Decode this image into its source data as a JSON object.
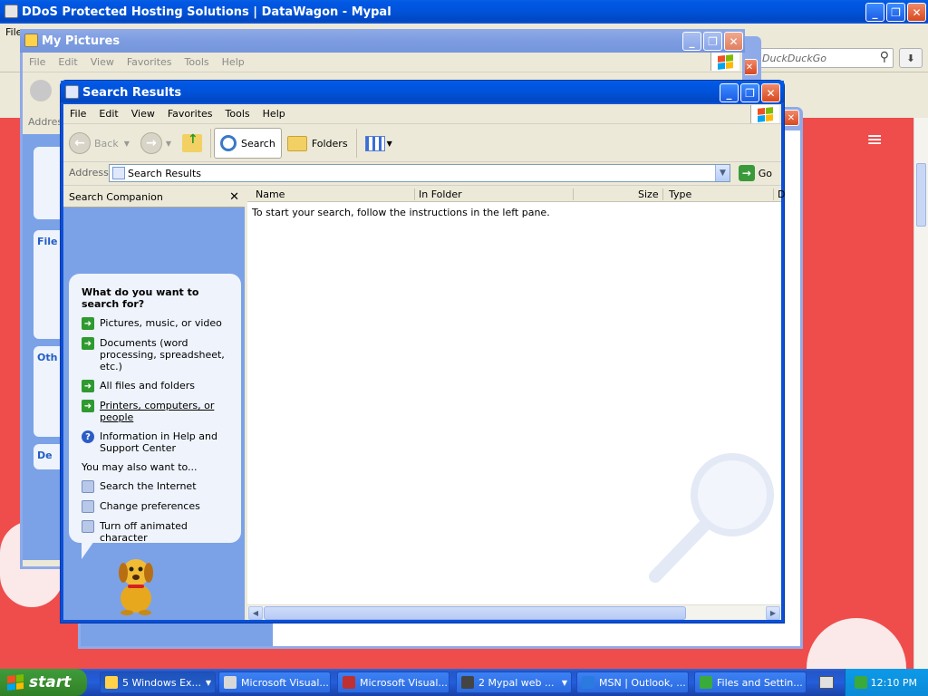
{
  "browser": {
    "title": "DDoS Protected Hosting Solutions  |  DataWagon - Mypal",
    "menu_file": "File",
    "search_placeholder": "DuckDuckGo",
    "hamburger": "≡"
  },
  "my_pictures": {
    "title": "My Pictures",
    "menu": [
      "File",
      "Edit",
      "View",
      "Favorites",
      "Tools",
      "Help"
    ],
    "address_label": "Address",
    "panel_labels": [
      "File",
      "Oth",
      "De"
    ]
  },
  "search_window": {
    "title": "Search Results",
    "menu": [
      "File",
      "Edit",
      "View",
      "Favorites",
      "Tools",
      "Help"
    ],
    "toolbar": {
      "back": "Back",
      "search": "Search",
      "folders": "Folders"
    },
    "address_label": "Address",
    "address_value": "Search Results",
    "go": "Go",
    "companion": {
      "header": "Search Companion",
      "close": "✕",
      "question": "What do you want to search for?",
      "options": [
        "Pictures, music, or video",
        "Documents (word processing, spreadsheet, etc.)",
        "All files and folders",
        "Printers, computers, or people",
        "Information in Help and Support Center"
      ],
      "also_label": "You may also want to...",
      "also_options": [
        "Search the Internet",
        "Change preferences",
        "Turn off animated character"
      ]
    },
    "columns": [
      "Name",
      "In Folder",
      "Size",
      "Type",
      "D"
    ],
    "empty_message": "To start your search, follow the instructions in the left pane."
  },
  "taskbar": {
    "start": "start",
    "tasks": [
      "5 Windows Ex...",
      "Microsoft Visual...",
      "Microsoft Visual...",
      "2 Mypal web ...",
      "MSN | Outlook, ...",
      "Files and Settin..."
    ],
    "clock": "12:10 PM"
  },
  "colors": {
    "page_bg": "#ef4c4c",
    "xp_blue": "#0b4fd8",
    "pane_blue": "#7ba2e7",
    "start_green": "#3a8f2f"
  }
}
